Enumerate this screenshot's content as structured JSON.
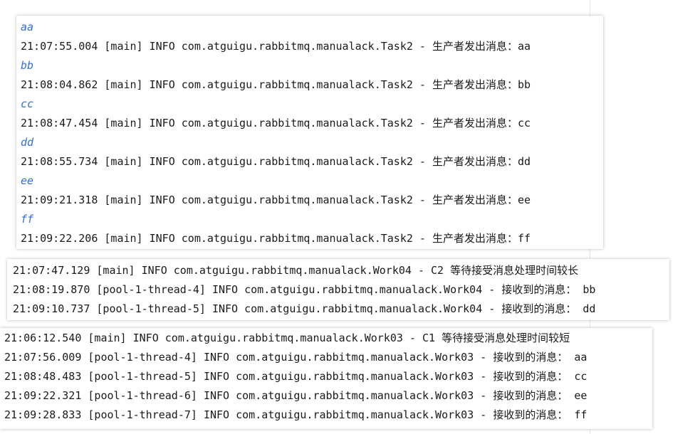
{
  "colors": {
    "input_text": "#2e6fd8",
    "log_text": "#1a1a1a",
    "panel_background": "#ffffff"
  },
  "task2_console": {
    "entries": [
      {
        "input": "aa",
        "log": "21:07:55.004 [main] INFO com.atguigu.rabbitmq.manualack.Task2 - 生产者发出消息：aa"
      },
      {
        "input": "bb",
        "log": "21:08:04.862 [main] INFO com.atguigu.rabbitmq.manualack.Task2 - 生产者发出消息：bb"
      },
      {
        "input": "cc",
        "log": "21:08:47.454 [main] INFO com.atguigu.rabbitmq.manualack.Task2 - 生产者发出消息：cc"
      },
      {
        "input": "dd",
        "log": "21:08:55.734 [main] INFO com.atguigu.rabbitmq.manualack.Task2 - 生产者发出消息：dd"
      },
      {
        "input": "ee",
        "log": "21:09:21.318 [main] INFO com.atguigu.rabbitmq.manualack.Task2 - 生产者发出消息：ee"
      },
      {
        "input": "ff",
        "log": "21:09:22.206 [main] INFO com.atguigu.rabbitmq.manualack.Task2 - 生产者发出消息：ff"
      }
    ]
  },
  "work04_console": {
    "lines": [
      "21:07:47.129 [main] INFO com.atguigu.rabbitmq.manualack.Work04 - C2 等待接受消息处理时间较长",
      "21:08:19.870 [pool-1-thread-4] INFO com.atguigu.rabbitmq.manualack.Work04 - 接收到的消息： bb",
      "21:09:10.737 [pool-1-thread-5] INFO com.atguigu.rabbitmq.manualack.Work04 - 接收到的消息： dd"
    ]
  },
  "work03_console": {
    "lines": [
      "21:06:12.540 [main] INFO com.atguigu.rabbitmq.manualack.Work03 - C1 等待接受消息处理时间较短",
      "21:07:56.009 [pool-1-thread-4] INFO com.atguigu.rabbitmq.manualack.Work03 - 接收到的消息： aa",
      "21:08:48.483 [pool-1-thread-5] INFO com.atguigu.rabbitmq.manualack.Work03 - 接收到的消息： cc",
      "21:09:22.321 [pool-1-thread-6] INFO com.atguigu.rabbitmq.manualack.Work03 - 接收到的消息： ee",
      "21:09:28.833 [pool-1-thread-7] INFO com.atguigu.rabbitmq.manualack.Work03 - 接收到的消息： ff"
    ]
  }
}
